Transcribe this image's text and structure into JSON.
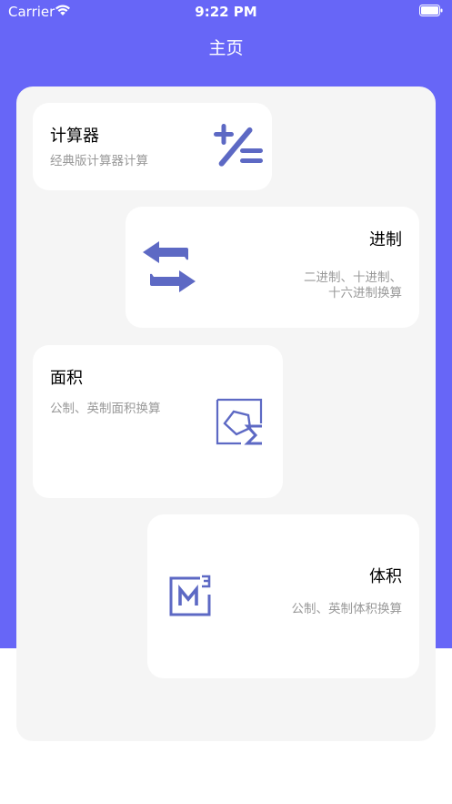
{
  "status_bar": {
    "carrier": "Carrier",
    "time": "9:22 PM",
    "icons": [
      "wifi-icon",
      "battery-icon"
    ]
  },
  "nav": {
    "title": "主页"
  },
  "colors": {
    "accent": "#6766f7",
    "icon": "#5d69c4",
    "panel": "#f5f5f5",
    "card": "#ffffff",
    "subtitle": "#999999"
  },
  "cards": [
    {
      "title": "计算器",
      "desc": "经典版计算器计算",
      "icon": "plus-divide-icon"
    },
    {
      "title": "进制",
      "desc_line1": "二进制、十进制、",
      "desc_line2": "十六进制换算",
      "icon": "exchange-arrows-icon"
    },
    {
      "title": "面积",
      "desc": "公制、英制面积换算",
      "icon": "area-icon"
    },
    {
      "title": "体积",
      "desc": "公制、英制体积换算",
      "icon": "volume-cube-icon"
    }
  ]
}
